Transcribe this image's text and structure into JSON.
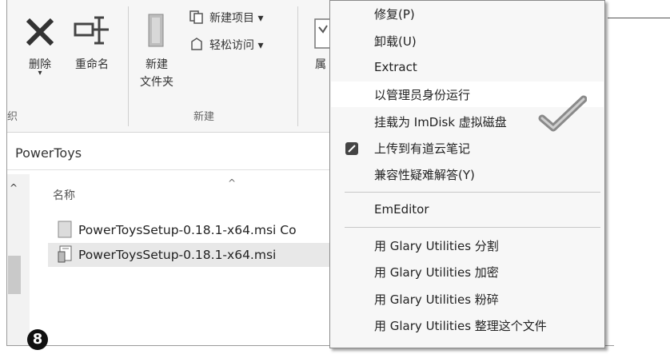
{
  "ribbon": {
    "delete_label": "删除",
    "rename_label": "重命名",
    "new_folder_label_line1": "新建",
    "new_folder_label_line2": "文件夹",
    "new_item_label": "新建项目 ▾",
    "easy_access_label": "轻松访问 ▾",
    "properties_label_partial": "属",
    "group_organize_partial": "织",
    "group_new": "新建"
  },
  "address": {
    "path": "PowerToys"
  },
  "file_list": {
    "column_name": "名称",
    "files": [
      {
        "name": "PowerToysSetup-0.18.1-x64.msi Co",
        "selected": false
      },
      {
        "name": "PowerToysSetup-0.18.1-x64.msi",
        "selected": true
      }
    ]
  },
  "context_menu": {
    "items": [
      {
        "label": "修复(P)"
      },
      {
        "label": "卸载(U)"
      },
      {
        "label": "Extract"
      },
      {
        "label": "以管理员身份运行",
        "highlighted": true
      },
      {
        "label": "挂载为 ImDisk 虚拟磁盘"
      },
      {
        "label": "上传到有道云笔记",
        "icon": "youdao-note-icon"
      },
      {
        "label": "兼容性疑难解答(Y)"
      },
      {
        "label": "EmEditor"
      },
      {
        "label": "用 Glary Utilities 分割"
      },
      {
        "label": "用 Glary Utilities 加密"
      },
      {
        "label": "用 Glary Utilities 粉碎"
      },
      {
        "label": "用 Glary Utilities 整理这个文件"
      }
    ]
  },
  "step_badge": "8"
}
